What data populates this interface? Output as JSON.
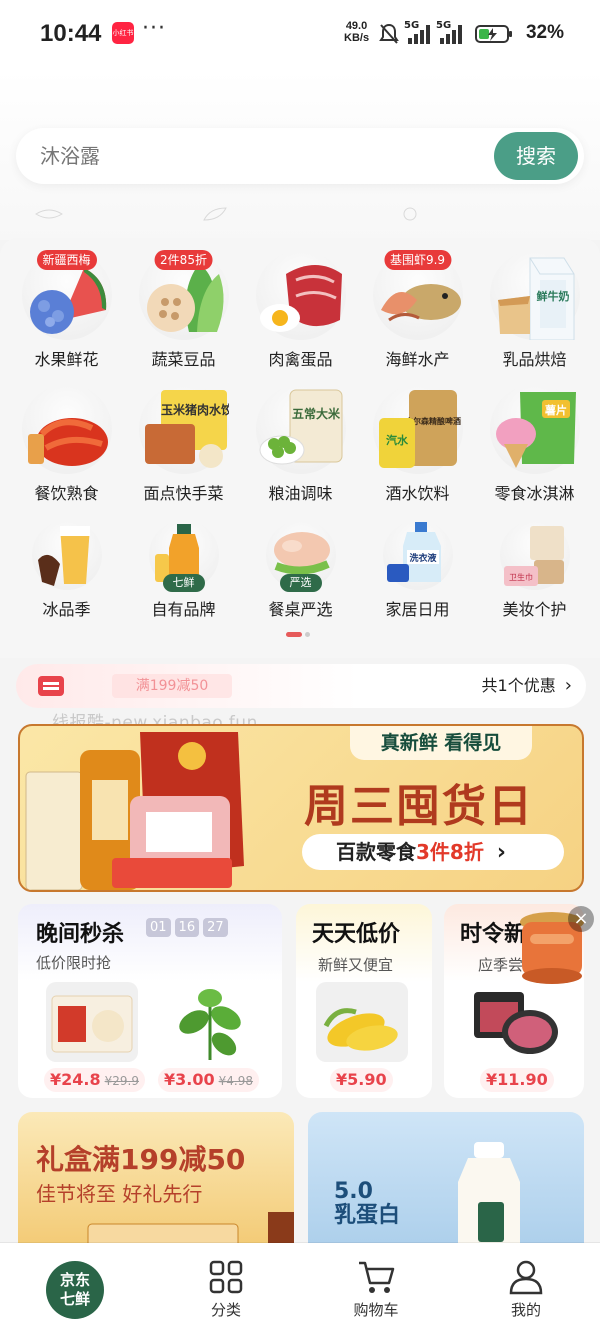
{
  "status_bar": {
    "time": "10:44",
    "app_badge": "小红书",
    "more": "···",
    "speed_value": "49.0",
    "speed_unit": "KB/s",
    "net1": "5G",
    "net2": "5G",
    "battery": "32%"
  },
  "search": {
    "placeholder": "沐浴露",
    "button_label": "搜索"
  },
  "categories": [
    {
      "label": "水果鲜花",
      "badge": "新疆西梅",
      "icon": "watermelon-hydrangea-icon"
    },
    {
      "label": "蔬菜豆品",
      "badge": "2件85折",
      "icon": "lotus-bokchoy-icon"
    },
    {
      "label": "肉禽蛋品",
      "badge": "",
      "icon": "steak-egg-icon"
    },
    {
      "label": "海鲜水产",
      "badge": "基围虾9.9",
      "icon": "seafood-icon"
    },
    {
      "label": "乳品烘焙",
      "badge": "",
      "icon": "milk-carton-icon"
    },
    {
      "label": "餐饮熟食",
      "badge": "",
      "icon": "crayfish-icon"
    },
    {
      "label": "面点快手菜",
      "badge": "",
      "icon": "dumpling-bag-icon"
    },
    {
      "label": "粮油调味",
      "badge": "",
      "icon": "rice-bag-icon"
    },
    {
      "label": "酒水饮料",
      "badge": "",
      "icon": "beer-can-icon"
    },
    {
      "label": "零食冰淇淋",
      "badge": "",
      "icon": "chips-icecream-icon"
    },
    {
      "label": "冰品季",
      "badge": "",
      "icon": "beer-glass-icon"
    },
    {
      "label": "自有品牌",
      "badge": "",
      "sub": "七鲜",
      "icon": "juice-bottle-icon"
    },
    {
      "label": "餐桌严选",
      "badge": "",
      "sub": "严选",
      "icon": "chicken-icon"
    },
    {
      "label": "家居日用",
      "badge": "",
      "icon": "detergent-icon"
    },
    {
      "label": "美妆个护",
      "badge": "",
      "icon": "cosmetics-icon"
    }
  ],
  "cat_images": {
    "dumpling_text": "玉米猪肉水饺",
    "rice_text": "五常大米",
    "can1": "汽水",
    "can2": "皮尔森精酿啤酒",
    "chips": "薯片",
    "milk": "鲜牛奶",
    "detergent": "洗衣液",
    "tissue": "卫生巾"
  },
  "coupon": {
    "ticket_text": "满199减50",
    "count_text": "共1个优惠",
    "arrow": "›"
  },
  "watermark": "线报酷-new.xianbao.fun",
  "banner": {
    "tag": "真新鲜 看得见",
    "title": "周三囤货日",
    "cta_prefix": "百款零食",
    "cta_highlight": "3件8折",
    "cta_arrow": "›"
  },
  "flash_sale": {
    "title": "晚间秒杀",
    "subtitle": "低价限时抢",
    "timer": [
      "01",
      "16",
      "27"
    ],
    "products": [
      {
        "price": "¥24.8",
        "old_price": "¥29.9",
        "icon": "shrimp-dumpling-pack-icon"
      },
      {
        "price": "¥3.00",
        "old_price": "¥4.98",
        "icon": "mint-leaves-icon"
      }
    ]
  },
  "daily_low": {
    "title": "天天低价",
    "subtitle": "新鲜又便宜",
    "products": [
      {
        "price": "¥5.90",
        "icon": "corn-icon"
      }
    ]
  },
  "seasonal": {
    "title": "时令新",
    "subtitle": "应季尝",
    "products": [
      {
        "price": "¥11.90",
        "icon": "beef-slices-icon"
      }
    ]
  },
  "gift_promo": {
    "title": "礼盒满199减50",
    "subtitle": "佳节将至 好礼先行"
  },
  "milk_promo": {
    "text1": "5.0",
    "text2": "乳蛋白"
  },
  "tab_bar": {
    "home_line1": "京东",
    "home_line2": "七鲜",
    "tabs": [
      "分类",
      "购物车",
      "我的"
    ]
  },
  "colors": {
    "accent_green": "#4b9e87",
    "brand_dark_green": "#2a6548",
    "price_red": "#e8434b"
  }
}
